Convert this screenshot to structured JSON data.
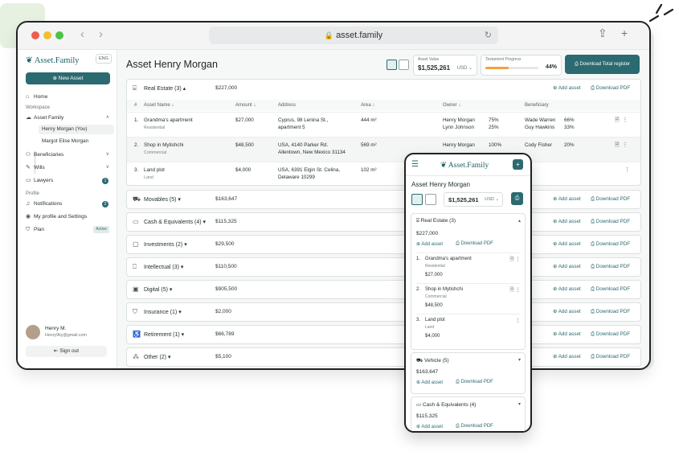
{
  "browser": {
    "url": "asset.family"
  },
  "sidebar": {
    "logo": "Asset.Family",
    "lang": "ENG",
    "new_asset": "New Asset",
    "home": "Home",
    "workspace_label": "Workspace",
    "asset_family": "Asset Family",
    "sub_items": [
      "Henry Morgan (You)",
      "Margot Elise Morgan"
    ],
    "beneficiaries": "Beneficiaries",
    "wills": "Wills",
    "lawyers": "Lawyers",
    "lawyers_badge": "1",
    "profile_label": "Profile",
    "notifications": "Notifications",
    "notifications_badge": "2",
    "my_profile": "My profile and Settings",
    "plan": "Plan",
    "plan_tag": "Active",
    "user_name": "Henry M.",
    "user_email": "Henry9ky@gmail.com",
    "sign_out": "Sign out"
  },
  "header": {
    "title": "Asset Henry Morgan",
    "asset_value_label": "Asset Value",
    "asset_value": "$1,525,261",
    "currency": "USD",
    "testament_label": "Testament Progress",
    "testament_progress": 0.44,
    "testament_pct": "44%",
    "download_register": "Download Total register"
  },
  "labels": {
    "add_asset": "Add asset",
    "download_pdf": "Download PDF"
  },
  "real_estate": {
    "name": "Real Estate (3)",
    "amount": "$227,000",
    "columns": [
      "#",
      "Asset Name ↓",
      "Amount ↓",
      "Address",
      "Area ↓",
      "Owner ↓",
      "Beneficiary"
    ],
    "rows": [
      {
        "no": "1.",
        "name": "Grandma's apartment",
        "type": "Residential",
        "amount": "$27,000",
        "addr1": "Cyprus, 98 Lenina St.,",
        "addr2": "apartment 5",
        "area": "444 m²",
        "owner1": "Henry Morgan",
        "owner1_pct": "75%",
        "owner2": "Lynn Johnson",
        "owner2_pct": "25%",
        "ben1": "Wade Warren",
        "ben1_pct": "66%",
        "ben2": "Guy Hawkins",
        "ben2_pct": "33%"
      },
      {
        "no": "2.",
        "name": "Shop in Mytishchi",
        "type": "Commercial",
        "amount": "$48,500",
        "addr1": "USA, 4140 Parker Rd.",
        "addr2": "Allentown, New Mexico 31134",
        "area": "569 m²",
        "owner1": "Henry Morgan",
        "owner1_pct": "100%",
        "owner2": "",
        "owner2_pct": "",
        "ben1": "Cody Fisher",
        "ben1_pct": "20%",
        "ben2": "",
        "ben2_pct": ""
      },
      {
        "no": "3.",
        "name": "Land plot",
        "type": "Land",
        "amount": "$4,000",
        "addr1": "USA, 6391 Elgin St. Celina,",
        "addr2": "Delaware 10299",
        "area": "102 m²",
        "owner1": "",
        "owner1_pct": "",
        "owner2": "",
        "owner2_pct": "",
        "ben1": "",
        "ben1_pct": "",
        "ben2": "",
        "ben2_pct": ""
      }
    ]
  },
  "categories": [
    {
      "name": "Movables (5)",
      "amount": "$163,647"
    },
    {
      "name": "Cash & Equivalents (4)",
      "amount": "$115,325"
    },
    {
      "name": "Investments (2)",
      "amount": "$29,500"
    },
    {
      "name": "Intellectual  (3)",
      "amount": "$110,500"
    },
    {
      "name": "Digital (5)",
      "amount": "$905,500"
    },
    {
      "name": "Insurance (1)",
      "amount": "$2,000"
    },
    {
      "name": "Retirement (1)",
      "amount": "$66,789"
    },
    {
      "name": "Other (2)",
      "amount": "$5,100"
    }
  ],
  "phone": {
    "logo": "Asset.Family",
    "title": "Asset Henry Morgan",
    "value": "$1,525,261",
    "currency": "USD",
    "real_estate": {
      "name": "Real Estate (3)",
      "amount": "$227,000"
    },
    "items": [
      {
        "no": "1.",
        "name": "Grandma's apartment",
        "type": "Residential",
        "amount": "$27,000"
      },
      {
        "no": "2.",
        "name": "Shop in Mytishchi",
        "type": "Commercial",
        "amount": "$48,500"
      },
      {
        "no": "3.",
        "name": "Land plot",
        "type": "Land",
        "amount": "$4,000"
      }
    ],
    "vehicle": {
      "name": "Vehicle (5)",
      "amount": "$163,647"
    },
    "cash": {
      "name": "Cash & Equivalents (4)",
      "amount": "$115,325"
    }
  }
}
